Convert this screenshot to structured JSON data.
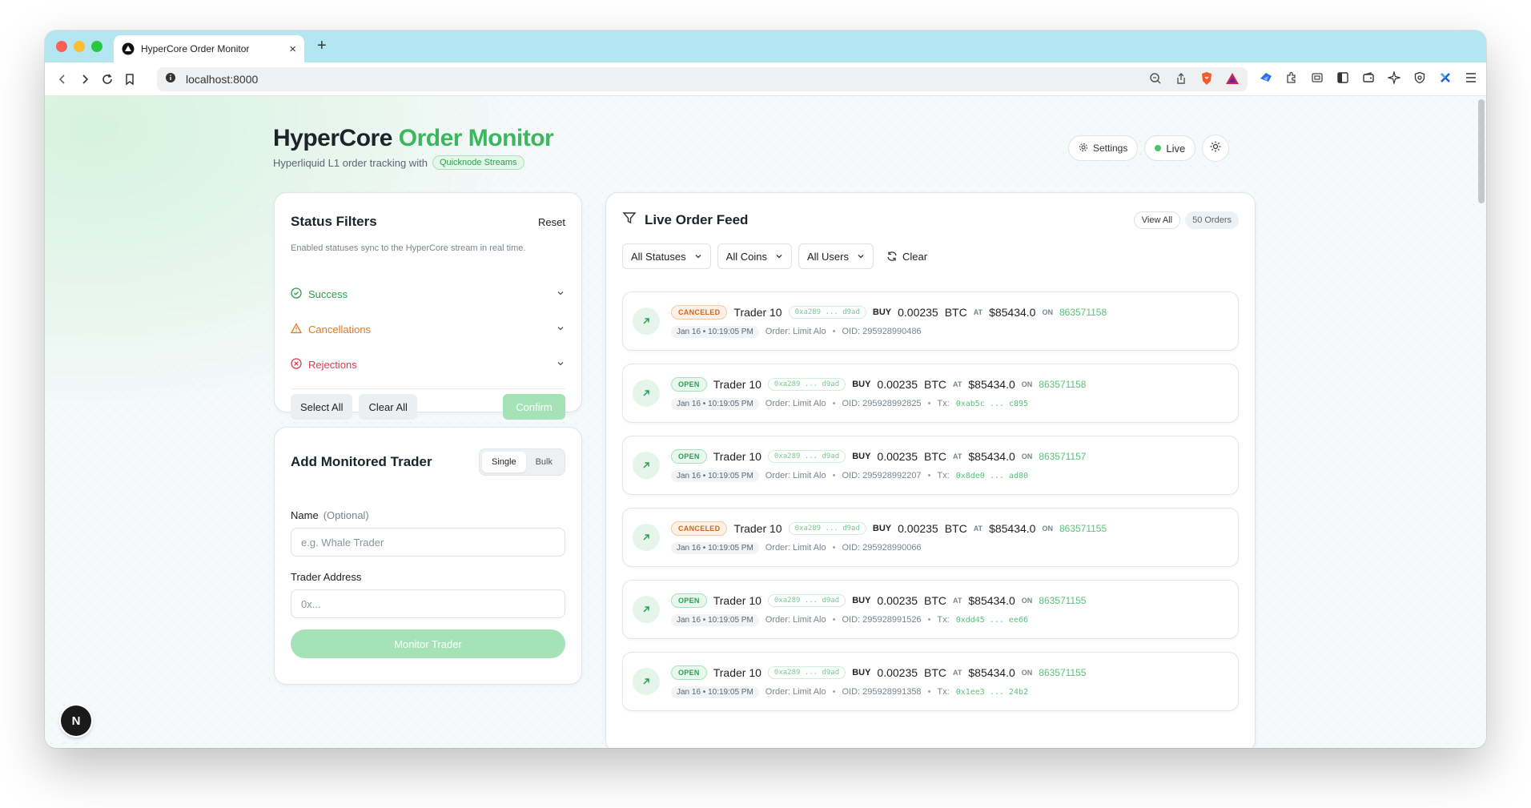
{
  "browser": {
    "tab_title": "HyperCore Order Monitor",
    "url": "localhost:8000"
  },
  "header": {
    "title_main": "HyperCore",
    "title_accent": "Order Monitor",
    "subtitle": "Hyperliquid L1 order tracking with",
    "subtitle_pill": "Quicknode Streams",
    "settings_label": "Settings",
    "live_label": "Live"
  },
  "filters": {
    "title": "Status Filters",
    "reset_label": "Reset",
    "description": "Enabled statuses sync to the HyperCore stream in real time.",
    "items": [
      {
        "label": "Success"
      },
      {
        "label": "Cancellations"
      },
      {
        "label": "Rejections"
      }
    ],
    "select_all_label": "Select All",
    "clear_all_label": "Clear All",
    "confirm_label": "Confirm"
  },
  "trader": {
    "title": "Add Monitored Trader",
    "seg_single": "Single",
    "seg_bulk": "Bulk",
    "name_label": "Name",
    "name_optional": "(Optional)",
    "name_placeholder": "e.g. Whale Trader",
    "address_label": "Trader Address",
    "address_placeholder": "0x...",
    "submit_label": "Monitor Trader"
  },
  "feed": {
    "title": "Live Order Feed",
    "view_all_label": "View All",
    "count_label": "50 Orders",
    "dropdowns": [
      "All Statuses",
      "All Coins",
      "All Users"
    ],
    "clear_label": "Clear",
    "orders": [
      {
        "status": "CANCELED",
        "trader": "Trader 10",
        "addr": "0xa289 ... d9ad",
        "side": "BUY",
        "amount": "0.00235",
        "coin": "BTC",
        "at": "AT",
        "price": "$85434.0",
        "on": "ON",
        "block": "863571158",
        "time": "Jan 16 • 10:19:05 PM",
        "order_type": "Order: Limit Alo",
        "oid": "OID: 295928990486",
        "tx_label": "",
        "tx": ""
      },
      {
        "status": "OPEN",
        "trader": "Trader 10",
        "addr": "0xa289 ... d9ad",
        "side": "BUY",
        "amount": "0.00235",
        "coin": "BTC",
        "at": "AT",
        "price": "$85434.0",
        "on": "ON",
        "block": "863571158",
        "time": "Jan 16 • 10:19:05 PM",
        "order_type": "Order: Limit Alo",
        "oid": "OID: 295928992825",
        "tx_label": "Tx:",
        "tx": "0xab5c ... c895"
      },
      {
        "status": "OPEN",
        "trader": "Trader 10",
        "addr": "0xa289 ... d9ad",
        "side": "BUY",
        "amount": "0.00235",
        "coin": "BTC",
        "at": "AT",
        "price": "$85434.0",
        "on": "ON",
        "block": "863571157",
        "time": "Jan 16 • 10:19:05 PM",
        "order_type": "Order: Limit Alo",
        "oid": "OID: 295928992207",
        "tx_label": "Tx:",
        "tx": "0x8de0 ... ad80"
      },
      {
        "status": "CANCELED",
        "trader": "Trader 10",
        "addr": "0xa289 ... d9ad",
        "side": "BUY",
        "amount": "0.00235",
        "coin": "BTC",
        "at": "AT",
        "price": "$85434.0",
        "on": "ON",
        "block": "863571155",
        "time": "Jan 16 • 10:19:05 PM",
        "order_type": "Order: Limit Alo",
        "oid": "OID: 295928990066",
        "tx_label": "",
        "tx": ""
      },
      {
        "status": "OPEN",
        "trader": "Trader 10",
        "addr": "0xa289 ... d9ad",
        "side": "BUY",
        "amount": "0.00235",
        "coin": "BTC",
        "at": "AT",
        "price": "$85434.0",
        "on": "ON",
        "block": "863571155",
        "time": "Jan 16 • 10:19:05 PM",
        "order_type": "Order: Limit Alo",
        "oid": "OID: 295928991526",
        "tx_label": "Tx:",
        "tx": "0xdd45 ... ee66"
      },
      {
        "status": "OPEN",
        "trader": "Trader 10",
        "addr": "0xa289 ... d9ad",
        "side": "BUY",
        "amount": "0.00235",
        "coin": "BTC",
        "at": "AT",
        "price": "$85434.0",
        "on": "ON",
        "block": "863571155",
        "time": "Jan 16 • 10:19:05 PM",
        "order_type": "Order: Limit Alo",
        "oid": "OID: 295928991358",
        "tx_label": "Tx:",
        "tx": "0x1ee3 ... 24b2"
      }
    ]
  },
  "dev_badge": "N",
  "colors": {
    "accent": "#3bb75e",
    "canceled": "#d4641a",
    "open": "#2d9d4f",
    "reject": "#dd3a4e"
  }
}
